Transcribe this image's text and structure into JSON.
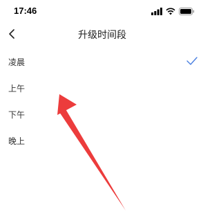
{
  "status_bar": {
    "time": "17:46"
  },
  "nav": {
    "title": "升级时间段",
    "back_icon": "chevron-left-icon"
  },
  "options": [
    {
      "label": "凌晨",
      "selected": true
    },
    {
      "label": "上午",
      "selected": false
    },
    {
      "label": "下午",
      "selected": false
    },
    {
      "label": "晚上",
      "selected": false
    }
  ],
  "colors": {
    "check": "#4a7fe0",
    "annotation_arrow": "#ec3c3c"
  }
}
